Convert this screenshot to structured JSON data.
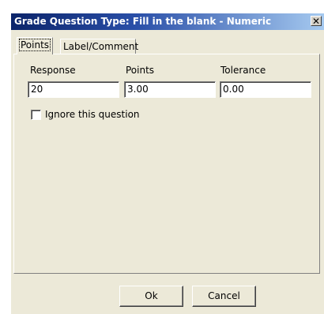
{
  "window": {
    "title": "Grade Question Type: Fill in the blank - Numeric",
    "close_glyph": "✕"
  },
  "tabs": [
    {
      "label": "Points",
      "active": true
    },
    {
      "label": "Label/Comment",
      "active": false
    }
  ],
  "columns": {
    "response_label": "Response",
    "points_label": "Points",
    "tolerance_label": "Tolerance"
  },
  "values": {
    "response": "20",
    "points": "3.00",
    "tolerance": "0.00"
  },
  "ignore_checkbox": {
    "label": "Ignore this question",
    "checked": false
  },
  "buttons": {
    "ok": "Ok",
    "cancel": "Cancel"
  }
}
